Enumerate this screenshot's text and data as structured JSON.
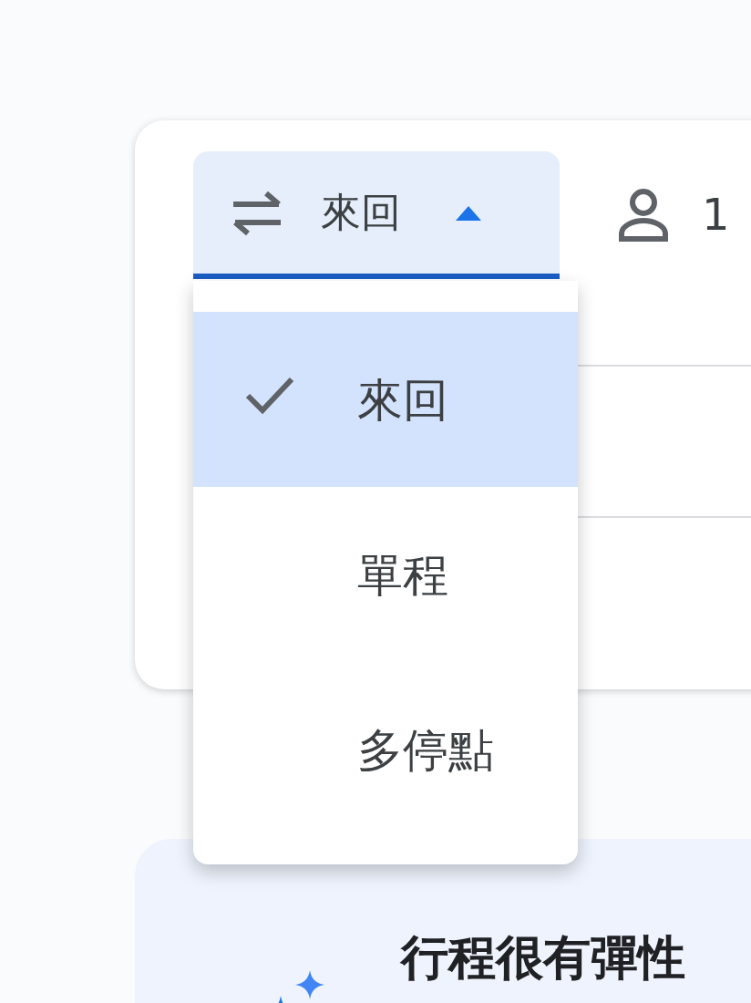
{
  "trip_type": {
    "label": "來回",
    "expanded": true
  },
  "passengers": {
    "count": "1"
  },
  "menu": [
    {
      "label": "來回",
      "selected": true
    },
    {
      "label": "單程",
      "selected": false
    },
    {
      "label": "多停點",
      "selected": false
    }
  ],
  "promo": {
    "title": "行程很有彈性"
  }
}
